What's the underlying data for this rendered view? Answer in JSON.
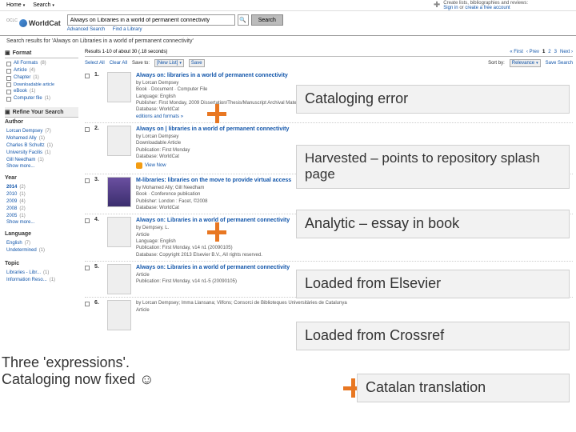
{
  "topnav": {
    "home": "Home",
    "search": "Search",
    "create1": "Create lists, bibliographies and reviews:",
    "create2": "Sign in",
    "create3": "or",
    "create4": "create a free account"
  },
  "logo": {
    "oclc": "OCLC",
    "name": "WorldCat"
  },
  "search": {
    "query": "Always on Libraries in a world of permanent connectivity",
    "button": "Search",
    "adv": "Advanced Search",
    "find": "Find a Library"
  },
  "summary": "Search results for 'Always on Libraries in a world of permanent connectivity'",
  "facets": {
    "format": {
      "title": "Format",
      "items": [
        {
          "label": "All Formats",
          "count": "(8)"
        },
        {
          "label": "Article",
          "count": "(4)"
        },
        {
          "label": "Chapter",
          "count": "(1)"
        },
        {
          "label": "Downloadable article",
          "count": ""
        },
        {
          "label": "eBook",
          "count": "(1)"
        },
        {
          "label": "Computer file",
          "count": "(1)"
        }
      ]
    },
    "refine": {
      "title": "Refine Your Search"
    },
    "author": {
      "title": "Author",
      "items": [
        {
          "label": "Lorcan Dempsey",
          "count": "(7)"
        },
        {
          "label": "Mohamed Ally",
          "count": "(1)"
        },
        {
          "label": "Charles B Schultz",
          "count": "(1)"
        },
        {
          "label": "University Facilis",
          "count": "(1)"
        },
        {
          "label": "Gill Needham",
          "count": "(1)"
        }
      ],
      "more": "Show more..."
    },
    "year": {
      "title": "Year",
      "y2014": "2014",
      "c2014": "(2)",
      "items": [
        {
          "label": "2010",
          "count": "(1)"
        },
        {
          "label": "2009",
          "count": "(4)"
        },
        {
          "label": "2008",
          "count": "(2)"
        },
        {
          "label": "2005",
          "count": "(1)"
        }
      ],
      "more": "Show more..."
    },
    "language": {
      "title": "Language",
      "items": [
        {
          "label": "English",
          "count": "(7)"
        },
        {
          "label": "Undetermined",
          "count": "(1)"
        }
      ]
    },
    "topic": {
      "title": "Topic",
      "items": [
        {
          "label": "Libraries - Libr...",
          "count": "(1)"
        },
        {
          "label": "Information Reso...",
          "count": "(1)"
        }
      ]
    }
  },
  "resultsbar": {
    "count": "Results 1-10 of about 30 (.18 seconds)",
    "first": "« First",
    "prev": "‹ Prev",
    "p1": "1",
    "p2": "2",
    "p3": "3",
    "next": "Next ›"
  },
  "actions": {
    "selectall": "Select All",
    "clearall": "Clear All",
    "saveto": "Save to:",
    "newlist": "[New List]",
    "save": "Save",
    "sortby": "Sort by:",
    "relevance": "Relevance",
    "savesearch": "Save Search"
  },
  "results": [
    {
      "num": "1.",
      "title": "Always on: libraries in a world of permanent connectivity",
      "by": "by Lorcan Dempsey",
      "type": "Book · Document · Computer File",
      "lang": "Language: English",
      "pub": "Publisher: First Monday, 2009   Dissertation/Thesis/Manuscript   Archival Material",
      "db": "Database: WorldCat",
      "link": "editions and formats »"
    },
    {
      "num": "2.",
      "title": "Always on | libraries in a world of permanent connectivity",
      "by": "by Lorcan Dempsey",
      "type": "Downloadable Article",
      "pub": "Publication: First Monday",
      "db": "Database: WorldCat",
      "view": "View Now"
    },
    {
      "num": "3.",
      "title": "M-libraries: libraries on the move to provide virtual access",
      "by": "by Mohamed Ally; Gill Needham",
      "type": "Book · Conference publication",
      "pub": "Publisher: London : Facet, ©2008",
      "db": "Database: WorldCat"
    },
    {
      "num": "4.",
      "title": "Always on: Libraries in a world of permanent connectivity",
      "by": "by Dempsey, L.",
      "type": "Article",
      "lang": "Language: English",
      "pub": "Publication: First Monday, v14 n1 (20090105)",
      "db": "Database: Copyright 2013 Elsevier B.V., All rights reserved."
    },
    {
      "num": "5.",
      "title": "Always on: Libraries in a world of permanent connectivity",
      "type": "Article",
      "pub": "Publication: First Monday, v14 n1-5 (20090105)"
    },
    {
      "num": "6.",
      "title": "",
      "by": "by Lorcan Dempsey; Imma Llansana; Vilfons; Consorci de Biblioteques Universitàries de Catalunya",
      "type": "Article"
    }
  ],
  "annot": {
    "a1": "Cataloging error",
    "a2": "Harvested – points to repository splash page",
    "a3": "Analytic – essay in book",
    "a4": "Loaded from Elsevier",
    "a5": "Loaded from Crossref",
    "a6": "Catalan translation"
  },
  "note": {
    "l1": "Three 'expressions'.",
    "l2": "Cataloging now fixed ☺"
  }
}
